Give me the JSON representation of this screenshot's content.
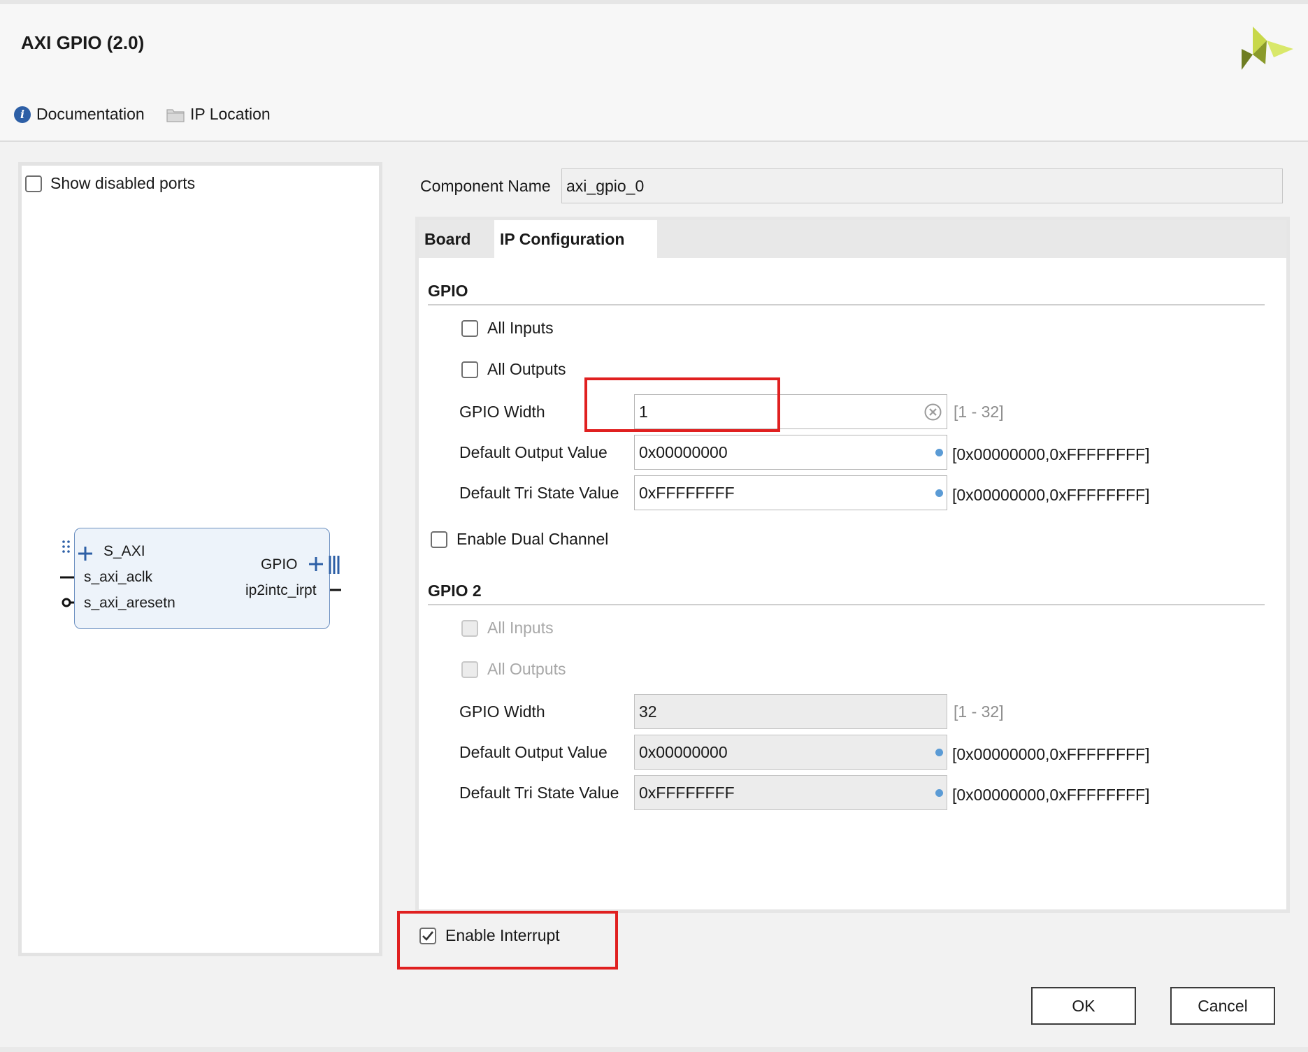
{
  "header": {
    "title": "AXI GPIO (2.0)"
  },
  "toolbar": {
    "documentation": "Documentation",
    "ip_location": "IP Location"
  },
  "left_panel": {
    "show_disabled_ports": "Show disabled ports",
    "block": {
      "left_ports": [
        "S_AXI",
        "s_axi_aclk",
        "s_axi_aresetn"
      ],
      "right_ports": [
        "GPIO",
        "ip2intc_irpt"
      ]
    }
  },
  "component": {
    "label": "Component Name",
    "value": "axi_gpio_0"
  },
  "tabs": {
    "board": "Board",
    "ip_configuration": "IP Configuration"
  },
  "gpio": {
    "title": "GPIO",
    "all_inputs": "All Inputs",
    "all_outputs": "All Outputs",
    "width_label": "GPIO Width",
    "width_value": "1",
    "width_range": "[1 - 32]",
    "default_output_label": "Default Output Value",
    "default_output_value": "0x00000000",
    "default_output_range": "[0x00000000,0xFFFFFFFF]",
    "default_tri_label": "Default Tri State Value",
    "default_tri_value": "0xFFFFFFFF",
    "default_tri_range": "[0x00000000,0xFFFFFFFF]"
  },
  "dual_channel": "Enable Dual Channel",
  "gpio2": {
    "title": "GPIO 2",
    "all_inputs": "All Inputs",
    "all_outputs": "All Outputs",
    "width_label": "GPIO Width",
    "width_value": "32",
    "width_range": "[1 - 32]",
    "default_output_label": "Default Output Value",
    "default_output_value": "0x00000000",
    "default_output_range": "[0x00000000,0xFFFFFFFF]",
    "default_tri_label": "Default Tri State Value",
    "default_tri_value": "0xFFFFFFFF",
    "default_tri_range": "[0x00000000,0xFFFFFFFF]"
  },
  "enable_interrupt": "Enable Interrupt",
  "buttons": {
    "ok": "OK",
    "cancel": "Cancel"
  },
  "colors": {
    "highlight": "#e02020",
    "block_fill": "#edf3fa",
    "accent_blue": "#2d5fa6"
  }
}
